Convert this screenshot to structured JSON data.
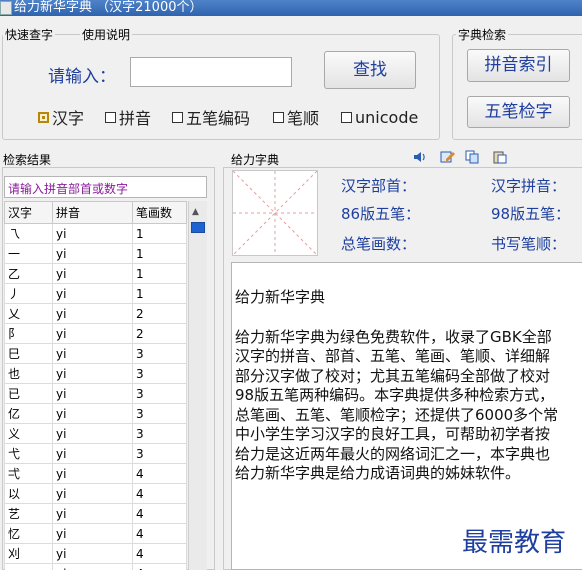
{
  "window": {
    "title": "给力新华字典 （汉字21000个）"
  },
  "quick_search": {
    "group_label": "快速查字",
    "help_label": "使用说明",
    "input_label": "请输入：",
    "input_value": "",
    "search_button": "查找",
    "modes": [
      {
        "label": "汉字",
        "checked": true
      },
      {
        "label": "拼音",
        "checked": false
      },
      {
        "label": "五笔编码",
        "checked": false
      },
      {
        "label": "笔顺",
        "checked": false
      },
      {
        "label": "unicode",
        "checked": false
      }
    ]
  },
  "dict_search": {
    "group_label": "字典检索",
    "pinyin_index_button": "拼音索引",
    "wubi_button": "五笔检字"
  },
  "results": {
    "section_label": "检索结果",
    "hint": "请输入拼音部首或数字",
    "columns": [
      "汉字",
      "拼音",
      "笔画数"
    ],
    "rows": [
      [
        "乁",
        "yi",
        "1"
      ],
      [
        "一",
        "yi",
        "1"
      ],
      [
        "乙",
        "yi",
        "1"
      ],
      [
        "丿",
        "yi",
        "1"
      ],
      [
        "乂",
        "yi",
        "2"
      ],
      [
        "阝",
        "yi",
        "2"
      ],
      [
        "巳",
        "yi",
        "3"
      ],
      [
        "也",
        "yi",
        "3"
      ],
      [
        "已",
        "yi",
        "3"
      ],
      [
        "亿",
        "yi",
        "3"
      ],
      [
        "义",
        "yi",
        "3"
      ],
      [
        "弋",
        "yi",
        "3"
      ],
      [
        "弌",
        "yi",
        "4"
      ],
      [
        "以",
        "yi",
        "4"
      ],
      [
        "艺",
        "yi",
        "4"
      ],
      [
        "忆",
        "yi",
        "4"
      ],
      [
        "刈",
        "yi",
        "4"
      ],
      [
        "",
        "yi",
        "4"
      ]
    ]
  },
  "dictionary": {
    "section_label": "给力字典",
    "icons": [
      "speaker-icon",
      "edit-icon",
      "copy-icon",
      "paste-icon"
    ],
    "info": {
      "radical_label": "汉字部首：",
      "pinyin_label": "汉字拼音：",
      "wubi86_label": "86版五笔：",
      "wubi98_label": "98版五笔：",
      "strokes_label": "总笔画数：",
      "order_label": "书写笔顺："
    },
    "content": {
      "heading": "给力新华字典",
      "lines": [
        "给力新华字典为绿色免费软件，收录了GBK全部",
        "汉字的拼音、部首、五笔、笔画、笔顺、详细解",
        "部分汉字做了校对；尤其五笔编码全部做了校对",
        "98版五笔两种编码。本字典提供多种检索方式，",
        "总笔画、五笔、笔顺检字；还提供了6000多个常",
        "中小学生学习汉字的良好工具，可帮助初学者按",
        "给力是这近两年最火的网络词汇之一，本字典也",
        "给力新华字典是给力成语词典的姊妹软件。"
      ]
    }
  },
  "watermark": "最需教育"
}
